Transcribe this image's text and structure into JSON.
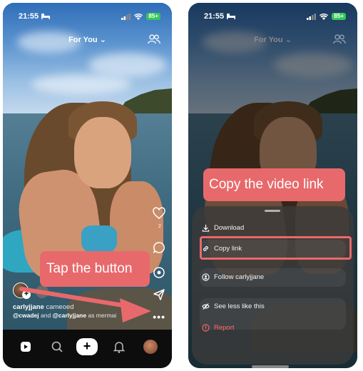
{
  "status_bar": {
    "time": "21:55",
    "battery": "85+"
  },
  "header": {
    "feed_title": "For You"
  },
  "post": {
    "like_count": "2",
    "creator": "carlyjjane",
    "caption_suffix": "cameoed",
    "cameo_line_users": [
      "@cwadej",
      "@carlyjjane"
    ],
    "cameo_line_connector": "and",
    "cameo_line_suffix": "as mermai"
  },
  "annotations": {
    "tap_button": "Tap the button",
    "copy_link": "Copy the video link",
    "color": "#e8696b"
  },
  "share_sheet": {
    "items": [
      {
        "label": "Download",
        "icon": "download-icon"
      },
      {
        "label": "Copy link",
        "icon": "link-icon"
      },
      {
        "label": "Follow carlyjjane",
        "icon": "follow-icon"
      },
      {
        "label": "See less like this",
        "icon": "eye-off-icon"
      },
      {
        "label": "Report",
        "icon": "report-icon"
      }
    ]
  },
  "tabbar": {
    "items": [
      "home-icon",
      "search-icon",
      "create-button",
      "notifications-icon",
      "profile-avatar"
    ],
    "create_symbol": "+"
  },
  "colors": {
    "accent": "#e8696b",
    "battery": "#35c759",
    "report": "#ff6b6b"
  }
}
